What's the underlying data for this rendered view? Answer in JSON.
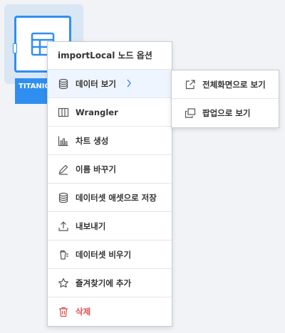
{
  "node": {
    "label": "TITANIC",
    "icon": "table-icon",
    "accent_color": "#2f8ff0"
  },
  "context_menu": {
    "title": "importLocal 노드 옵션",
    "items": [
      {
        "label": "데이터 보기",
        "icon": "database-icon",
        "active": true,
        "has_submenu": true
      },
      {
        "label": "Wrangler",
        "icon": "columns-icon"
      },
      {
        "label": "차트 생성",
        "icon": "bar-chart-icon"
      },
      {
        "label": "이름 바꾸기",
        "icon": "pencil-icon"
      },
      {
        "label": "데이터셋 애셋으로 저장",
        "icon": "database-icon"
      },
      {
        "label": "내보내기",
        "icon": "upload-icon"
      },
      {
        "label": "데이터셋 비우기",
        "icon": "trash-empty-icon"
      },
      {
        "label": "즐겨찾기에 추가",
        "icon": "star-icon"
      },
      {
        "label": "삭제",
        "icon": "trash-icon",
        "danger": true,
        "color": "#e14b4b"
      }
    ]
  },
  "submenu": {
    "items": [
      {
        "label": "전체화면으로 보기",
        "icon": "external-link-icon"
      },
      {
        "label": "팝업으로 보기",
        "icon": "popup-window-icon"
      }
    ]
  }
}
